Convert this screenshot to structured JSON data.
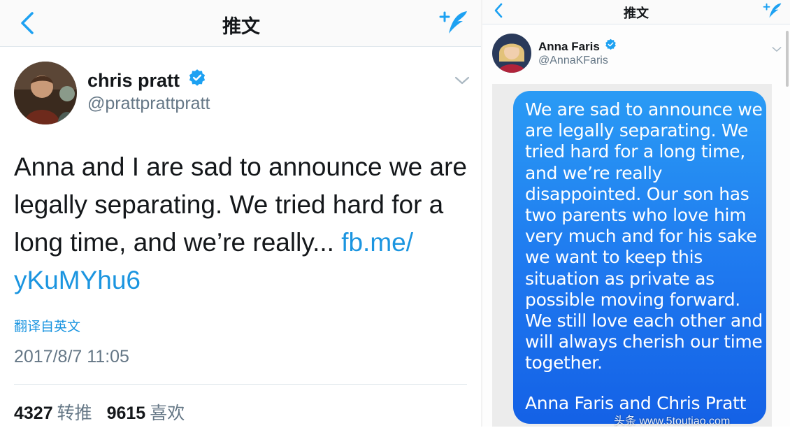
{
  "left": {
    "nav": {
      "title": "推文"
    },
    "tweet": {
      "name": "chris pratt",
      "handle": "@prattprattpratt",
      "text": "Anna and I are sad to announce we are legally separating. We tried hard for a long time, and we’re really... ",
      "link": "fb.me/ yKuMYhu6",
      "translate": "翻译自英文",
      "timestamp": "2017/8/7 11:05",
      "retweets_count": "4327",
      "retweets_label": "转推",
      "likes_count": "9615",
      "likes_label": "喜欢"
    }
  },
  "right": {
    "nav": {
      "title": "推文"
    },
    "tweet": {
      "name": "Anna Faris",
      "handle": "@AnnaKFaris",
      "image_text": "We are sad to announce we are legally separating. We tried hard for a long time, and we’re really disappointed.  Our son has two parents who love him very much and for his sake we want to keep this situation as private as possible moving forward. We still love each other and will always cherish our time together.",
      "image_signature": "Anna Faris and Chris Pratt"
    }
  },
  "watermark": "头条 www.5toutiao.com",
  "colors": {
    "twitter_blue": "#1da1f2",
    "link_blue": "#1b95e0",
    "gray_text": "#657786",
    "bubble_blue": "#1e78ef"
  },
  "icons": [
    "back-chevron-icon",
    "compose-tweet-icon",
    "verified-badge-icon",
    "dropdown-caret-icon"
  ]
}
